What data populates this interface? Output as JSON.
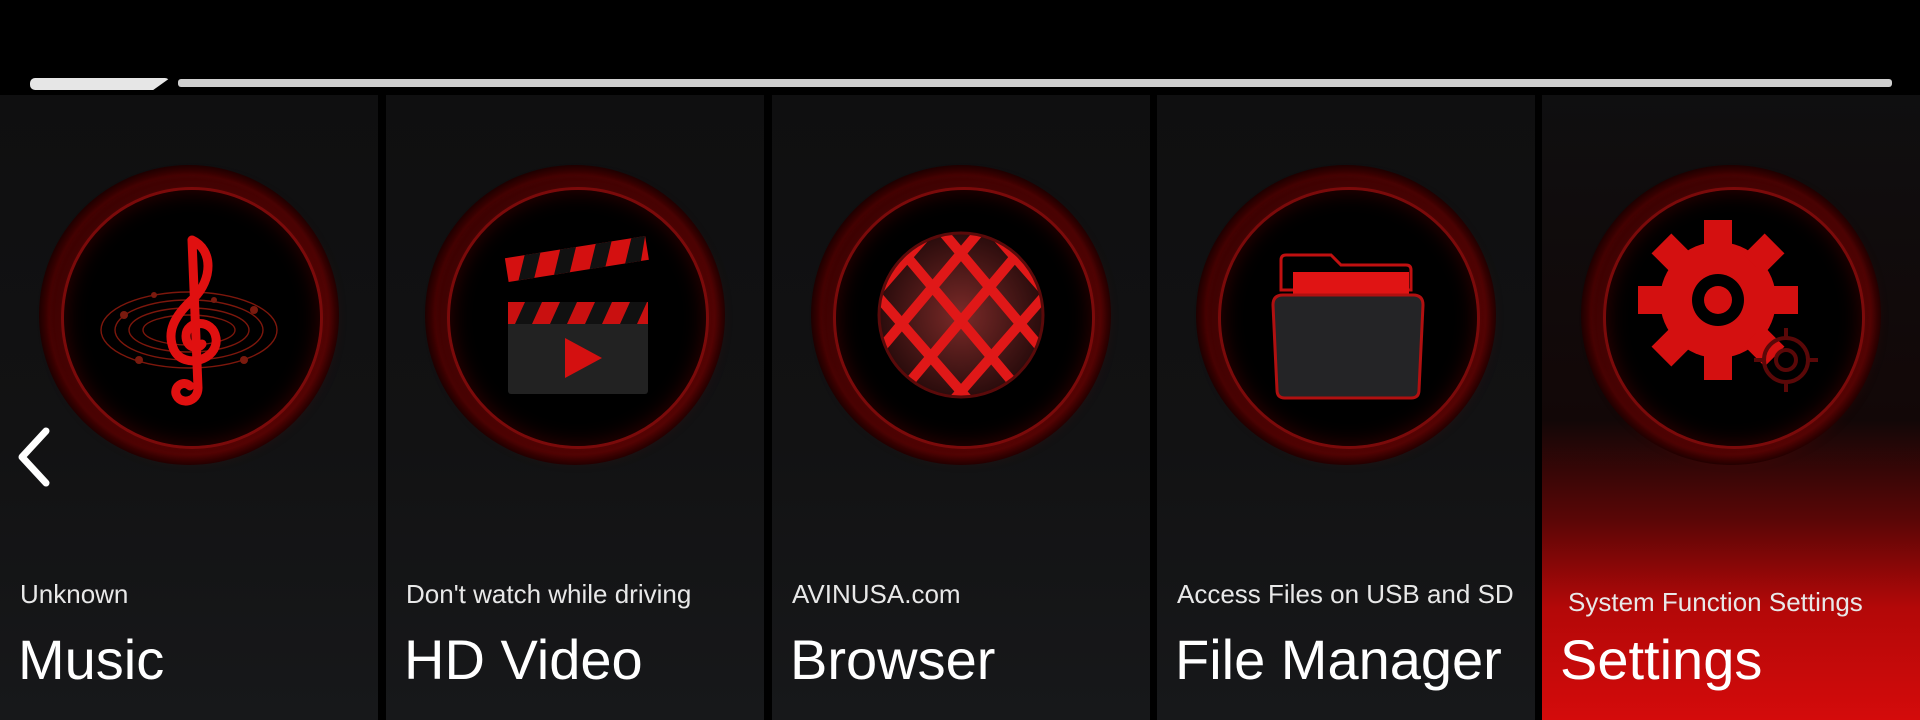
{
  "tiles": [
    {
      "subtitle": "Unknown",
      "title": "Music",
      "icon": "music-note-icon"
    },
    {
      "subtitle": "Don't watch while driving",
      "title": "HD Video",
      "icon": "clapperboard-icon"
    },
    {
      "subtitle": "AVINUSA.com",
      "title": "Browser",
      "icon": "globe-icon"
    },
    {
      "subtitle": "Access Files on USB and SD",
      "title": "File Manager",
      "icon": "folder-icon"
    },
    {
      "subtitle": "System Function Settings",
      "title": "Settings",
      "icon": "gear-icon",
      "active": true
    }
  ],
  "colors": {
    "accent": "#d40b0b",
    "background": "#000000",
    "tile": "#121213"
  }
}
